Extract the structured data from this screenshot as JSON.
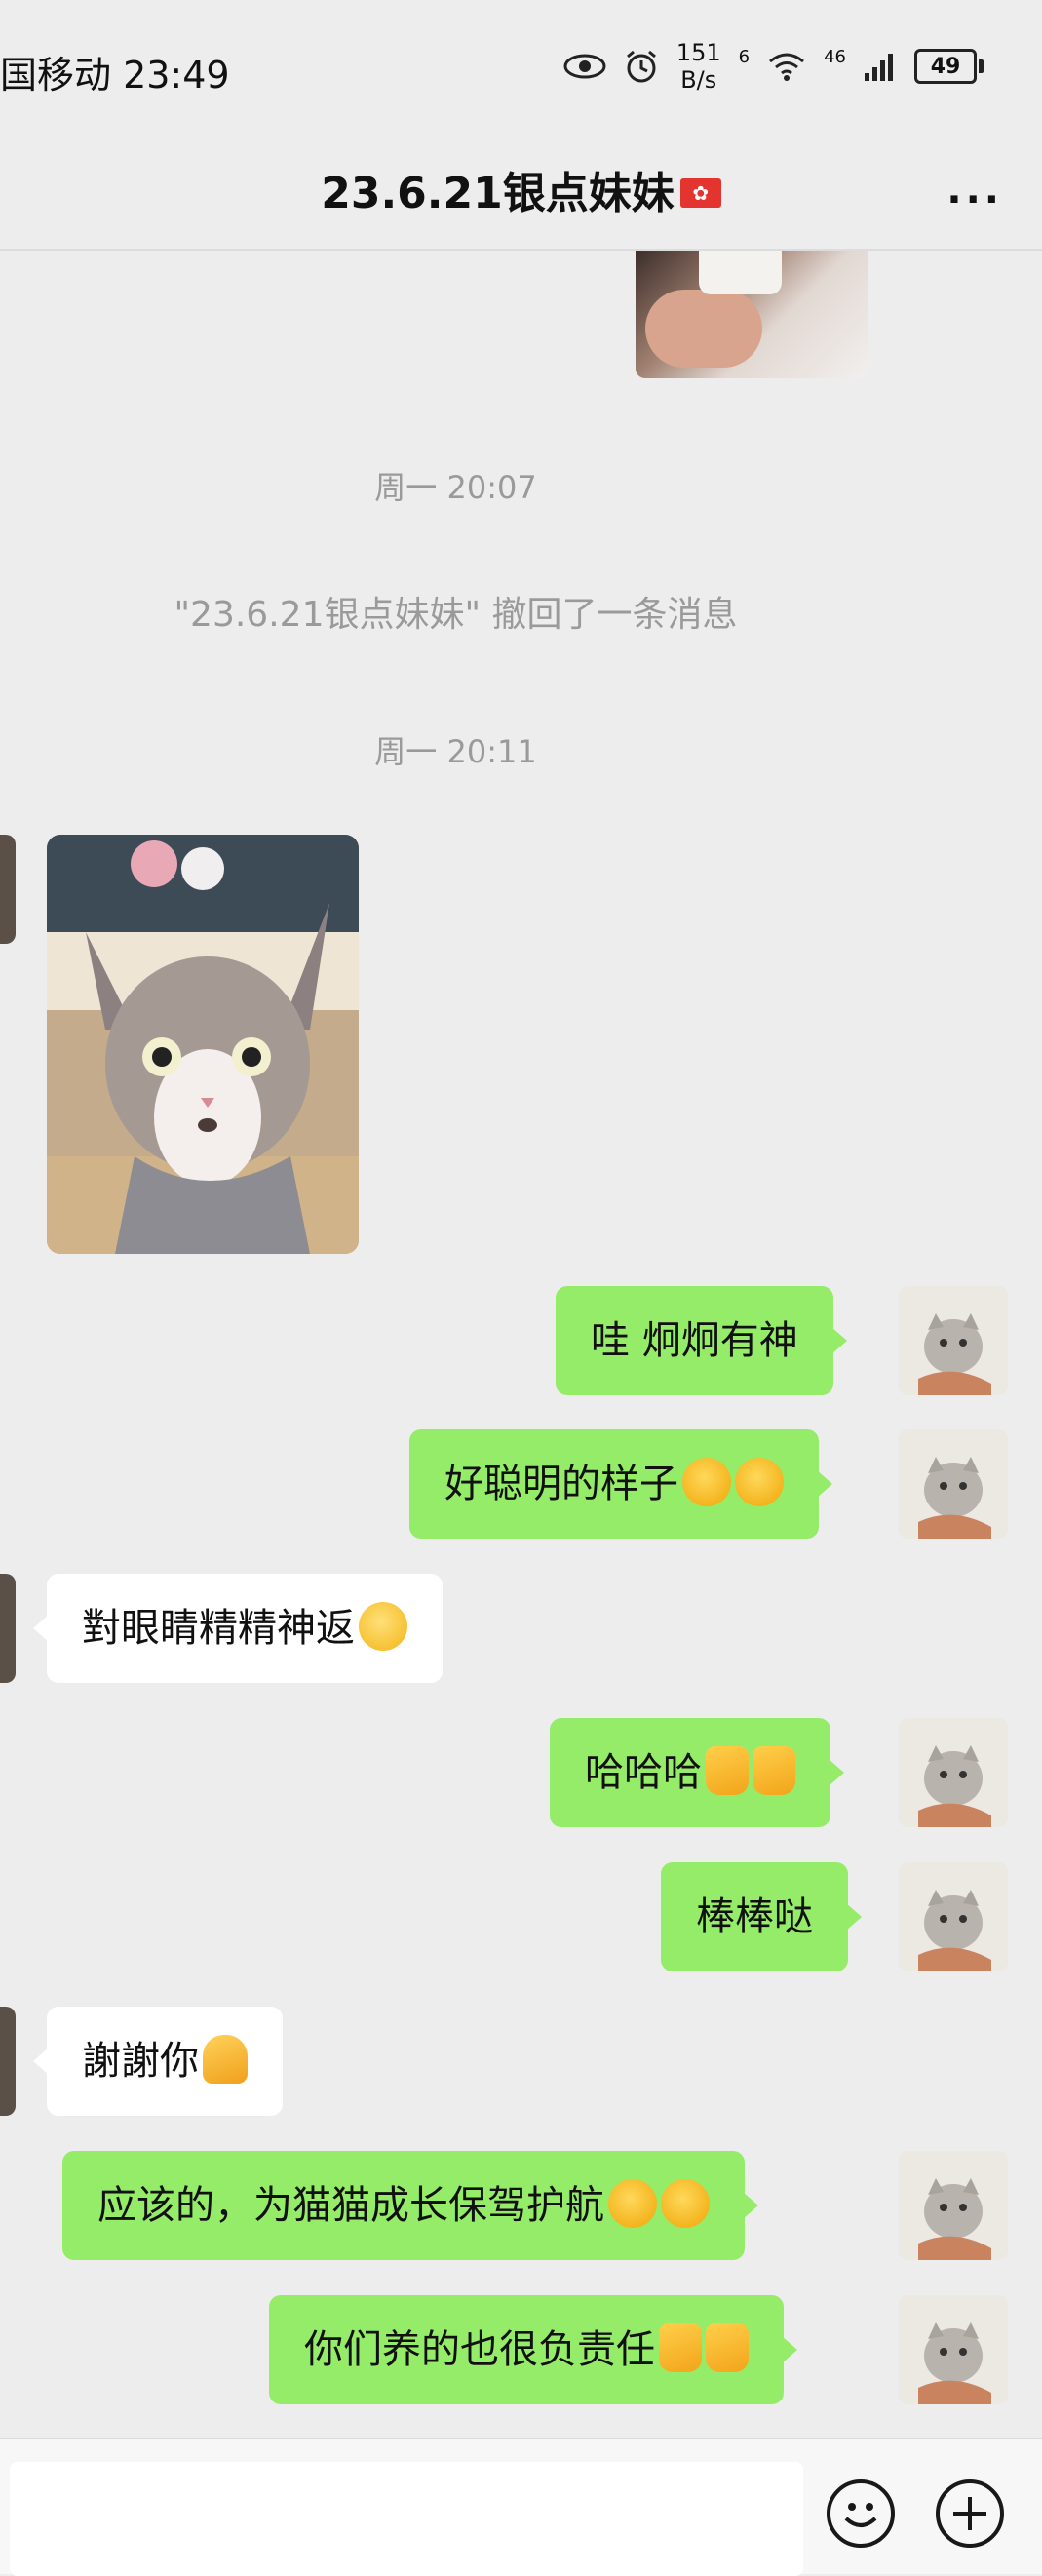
{
  "status_bar": {
    "carrier_time": "国移动 23:49",
    "net_speed_value": "151",
    "net_speed_unit": "B/s",
    "signal_label_1": "6",
    "signal_label_2": "46",
    "battery": "49",
    "icons": [
      "eye-icon",
      "alarm-icon",
      "wifi-icon",
      "signal-icon",
      "battery-icon"
    ]
  },
  "header": {
    "title": "23.6.21银点妹妹",
    "title_flag_icon": "hong-kong-flag-icon",
    "more_label": "···"
  },
  "messages": {
    "ts1": "周一 20:07",
    "recall_notice": "\"23.6.21银点妹妹\" 撤回了一条消息",
    "ts2": "周一 20:11",
    "m1": "哇 炯炯有神",
    "m2": "好聪明的样子",
    "m3": "對眼睛精精神返",
    "m4": "哈哈哈",
    "m5": "棒棒哒",
    "m6": "謝謝你",
    "m7": "应该的，为猫猫成长保驾护航",
    "m8": "你们养的也很负责任"
  },
  "input_bar": {
    "placeholder": "",
    "emoji_icon": "emoji-icon",
    "plus_icon": "plus-icon"
  },
  "colors": {
    "background": "#ededed",
    "self_bubble": "#95ec69",
    "other_bubble": "#ffffff"
  }
}
